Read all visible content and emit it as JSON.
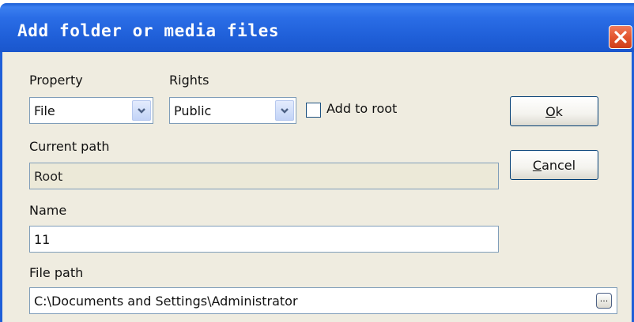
{
  "window": {
    "title": "Add folder or media files",
    "colors": {
      "titlebar": "#1f5fd8",
      "close": "#e3552f",
      "client": "#efece0"
    }
  },
  "property": {
    "label": "Property",
    "selected": "File"
  },
  "rights": {
    "label": "Rights",
    "selected": "Public"
  },
  "add_to_root": {
    "label": "Add to root",
    "checked": false
  },
  "buttons": {
    "ok": {
      "mnemonic": "O",
      "rest": "k"
    },
    "cancel": {
      "mnemonic": "C",
      "rest": "ancel"
    }
  },
  "current_path": {
    "label": "Current path",
    "value": "Root"
  },
  "name": {
    "label": "Name",
    "value": "11"
  },
  "file_path": {
    "label": "File path",
    "value": "C:\\Documents and Settings\\Administrator",
    "browse_label": "..."
  },
  "icons": [
    "close-icon",
    "chevron-down-icon",
    "ellipsis-icon"
  ]
}
